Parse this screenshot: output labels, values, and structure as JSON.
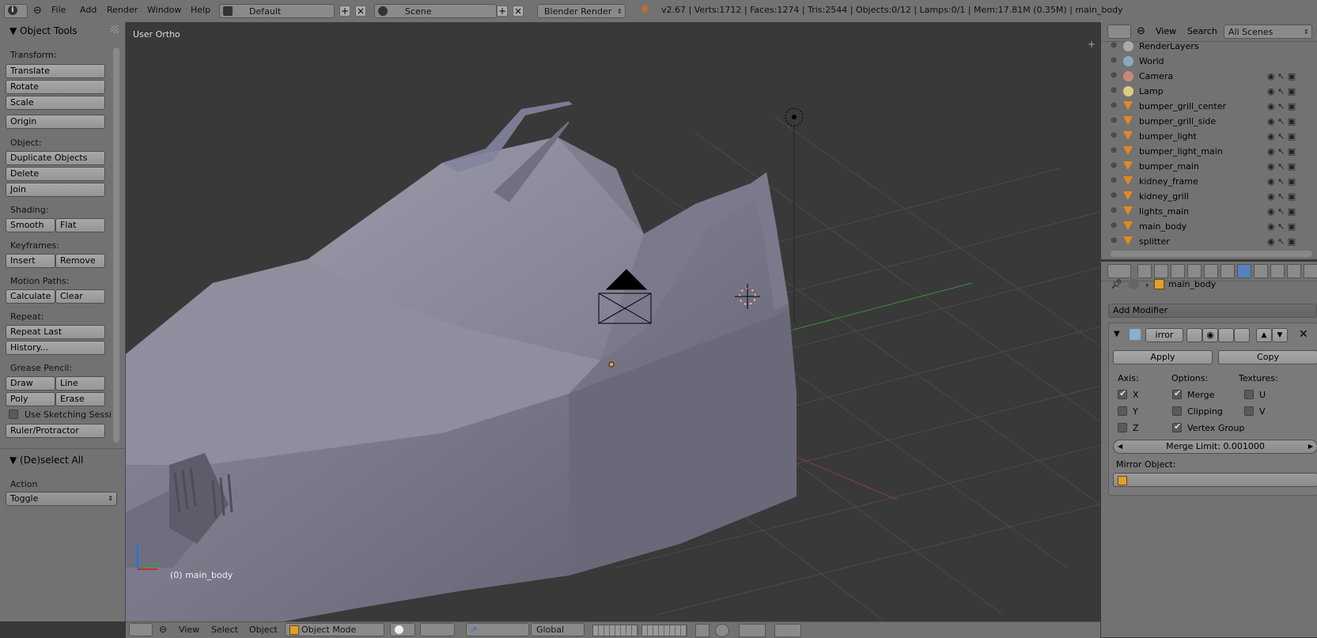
{
  "topbar": {
    "menus": [
      "File",
      "Add",
      "Render",
      "Window",
      "Help"
    ],
    "layout": "Default",
    "scene": "Scene",
    "engine": "Blender Render",
    "stats": "v2.67 | Verts:1712 | Faces:1274 | Tris:2544 | Objects:0/12 | Lamps:0/1 | Mem:17.81M (0.35M) | main_body"
  },
  "toolshelf": {
    "title": "Object Tools",
    "transform_label": "Transform:",
    "translate": "Translate",
    "rotate": "Rotate",
    "scale": "Scale",
    "origin": "Origin",
    "object_label": "Object:",
    "duplicate": "Duplicate Objects",
    "delete": "Delete",
    "join": "Join",
    "shading_label": "Shading:",
    "smooth": "Smooth",
    "flat": "Flat",
    "keyframes_label": "Keyframes:",
    "insert": "Insert",
    "remove": "Remove",
    "motion_label": "Motion Paths:",
    "calculate": "Calculate",
    "clear": "Clear",
    "repeat_label": "Repeat:",
    "repeat_last": "Repeat Last",
    "history": "History...",
    "grease_label": "Grease Pencil:",
    "draw": "Draw",
    "line": "Line",
    "poly": "Poly",
    "erase": "Erase",
    "sketching": "Use Sketching Sessi",
    "ruler": "Ruler/Protractor",
    "deselect_title": "(De)select All",
    "action_label": "Action",
    "action_value": "Toggle"
  },
  "viewport": {
    "view_label": "User Ortho",
    "object_label": "(0) main_body"
  },
  "outliner": {
    "view": "View",
    "search": "Search",
    "scenes": "All Scenes",
    "items": [
      {
        "name": "RenderLayers",
        "kind": "renderlayers"
      },
      {
        "name": "World",
        "kind": "world"
      },
      {
        "name": "Camera",
        "kind": "camera"
      },
      {
        "name": "Lamp",
        "kind": "lamp"
      },
      {
        "name": "bumper_grill_center",
        "kind": "mesh"
      },
      {
        "name": "bumper_grill_side",
        "kind": "mesh"
      },
      {
        "name": "bumper_light",
        "kind": "mesh"
      },
      {
        "name": "bumper_light_main",
        "kind": "mesh"
      },
      {
        "name": "bumper_main",
        "kind": "mesh"
      },
      {
        "name": "kidney_frame",
        "kind": "mesh"
      },
      {
        "name": "kidney_grill",
        "kind": "mesh"
      },
      {
        "name": "lights_main",
        "kind": "mesh"
      },
      {
        "name": "main_body",
        "kind": "mesh"
      },
      {
        "name": "splitter",
        "kind": "mesh"
      }
    ]
  },
  "properties": {
    "object_name": "main_body",
    "add_modifier": "Add Modifier",
    "modifier_name": "irror",
    "apply": "Apply",
    "copy": "Copy",
    "axis_label": "Axis:",
    "options_label": "Options:",
    "textures_label": "Textures:",
    "x": "X",
    "y": "Y",
    "z": "Z",
    "merge": "Merge",
    "clipping": "Clipping",
    "vertex_group": "Vertex Group",
    "u": "U",
    "v": "V",
    "merge_limit": "Merge Limit: 0.001000",
    "mirror_object_label": "Mirror Object:"
  },
  "bottombar": {
    "view": "View",
    "select": "Select",
    "object": "Object",
    "mode": "Object Mode",
    "orientation": "Global"
  },
  "colors": {
    "panel": "#727272",
    "viewport": "#393939",
    "button": "#9e9e9e",
    "highlight": "#5680c2"
  }
}
